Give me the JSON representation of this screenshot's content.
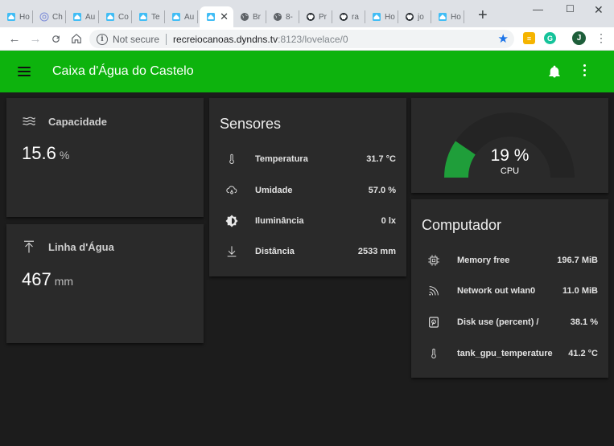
{
  "browser": {
    "tabs": [
      {
        "label": "Ho",
        "icon": "home-assistant-icon"
      },
      {
        "label": "Ch",
        "icon": "chrome-icon"
      },
      {
        "label": "Au",
        "icon": "home-assistant-icon"
      },
      {
        "label": "Co",
        "icon": "home-assistant-icon"
      },
      {
        "label": "Te",
        "icon": "home-assistant-icon"
      },
      {
        "label": "Au",
        "icon": "home-assistant-icon"
      },
      {
        "label": "",
        "icon": "home-assistant-icon",
        "active": true
      },
      {
        "label": "Br",
        "icon": "globe-icon"
      },
      {
        "label": "8-",
        "icon": "globe-icon"
      },
      {
        "label": "Pr",
        "icon": "github-icon"
      },
      {
        "label": "ra",
        "icon": "github-icon"
      },
      {
        "label": "Ho",
        "icon": "home-assistant-icon"
      },
      {
        "label": "jo",
        "icon": "github-icon"
      },
      {
        "label": "Ho",
        "icon": "home-assistant-icon"
      }
    ],
    "security_label": "Not secure",
    "url_host": "recreiocanoas.dyndns.tv",
    "url_path": ":8123/lovelace/0",
    "profile_initial": "J",
    "colors": {
      "tabstrip": "#dee1e6",
      "bookmark_star": "#1a73e8"
    }
  },
  "header": {
    "title": "Caixa d'Água do Castelo",
    "color": "#0db30d"
  },
  "capacidade": {
    "name": "Capacidade",
    "icon": "waves-icon",
    "value": "15.6",
    "unit": "%"
  },
  "linha": {
    "name": "Linha d'Água",
    "icon": "arrow-up-icon",
    "value": "467",
    "unit": "mm"
  },
  "sensores": {
    "title": "Sensores",
    "rows": [
      {
        "name": "Temperatura",
        "value": "31.7 °C",
        "icon": "thermometer-icon"
      },
      {
        "name": "Umidade",
        "value": "57.0 %",
        "icon": "cloud-humidity-icon"
      },
      {
        "name": "Iluminância",
        "value": "0 lx",
        "icon": "brightness-icon"
      },
      {
        "name": "Distância",
        "value": "2533 mm",
        "icon": "arrow-down-icon"
      }
    ]
  },
  "cpu": {
    "value_text": "19 %",
    "value": 19,
    "label": "CPU",
    "accent": "#1f9e3a"
  },
  "computador": {
    "title": "Computador",
    "rows": [
      {
        "name": "Memory free",
        "value": "196.7 MiB",
        "icon": "chip-icon"
      },
      {
        "name": "Network out wlan0",
        "value": "11.0 MiB",
        "icon": "wifi-icon"
      },
      {
        "name": "Disk use (percent) /",
        "value": "38.1 %",
        "icon": "harddisk-icon"
      },
      {
        "name": "tank_gpu_temperature",
        "value": "41.2 °C",
        "icon": "thermometer-icon"
      }
    ]
  }
}
